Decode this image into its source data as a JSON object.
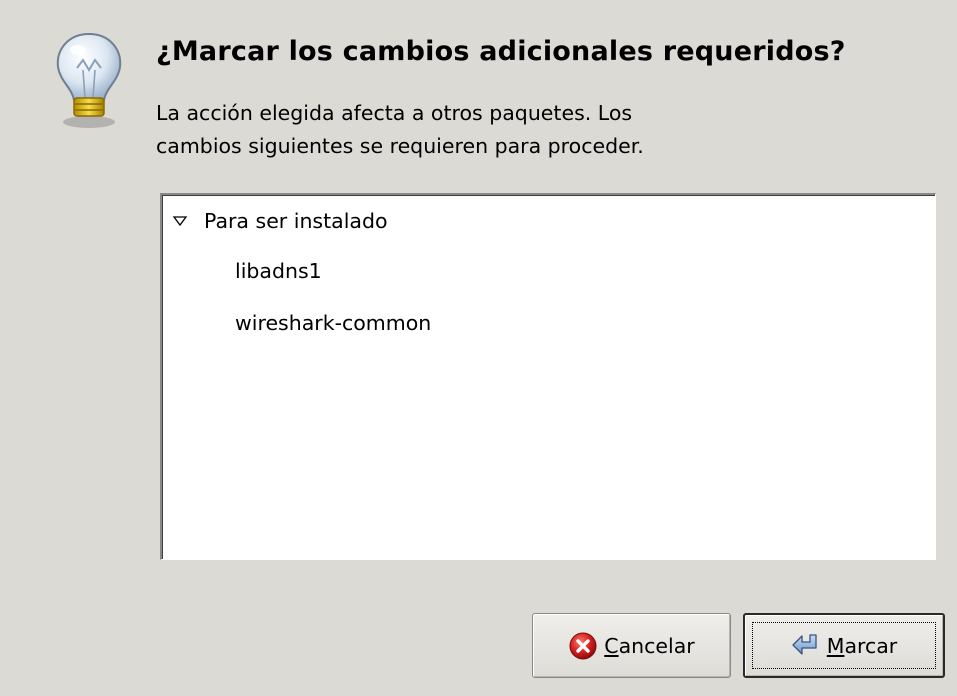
{
  "dialog": {
    "icon": "lightbulb-icon",
    "title": "¿Marcar los cambios adicionales requeridos?",
    "message": "La acción elegida afecta a otros paquetes. Los\ncambios siguientes se requieren para proceder."
  },
  "changes": {
    "groups": [
      {
        "label": "Para ser instalado",
        "expanded": true,
        "items": [
          "libadns1",
          "wireshark-common"
        ]
      }
    ]
  },
  "buttons": {
    "cancel": {
      "icon": "cancel-icon",
      "mnemonic": "C",
      "label_rest": "ancelar"
    },
    "mark": {
      "icon": "apply-arrow-icon",
      "mnemonic": "M",
      "label_rest": "arcar"
    }
  },
  "colors": {
    "window_bg": "#dcdad5",
    "list_bg": "#ffffff",
    "cancel_icon_red": "#d42020",
    "apply_icon_blue": "#7ea7d6"
  }
}
